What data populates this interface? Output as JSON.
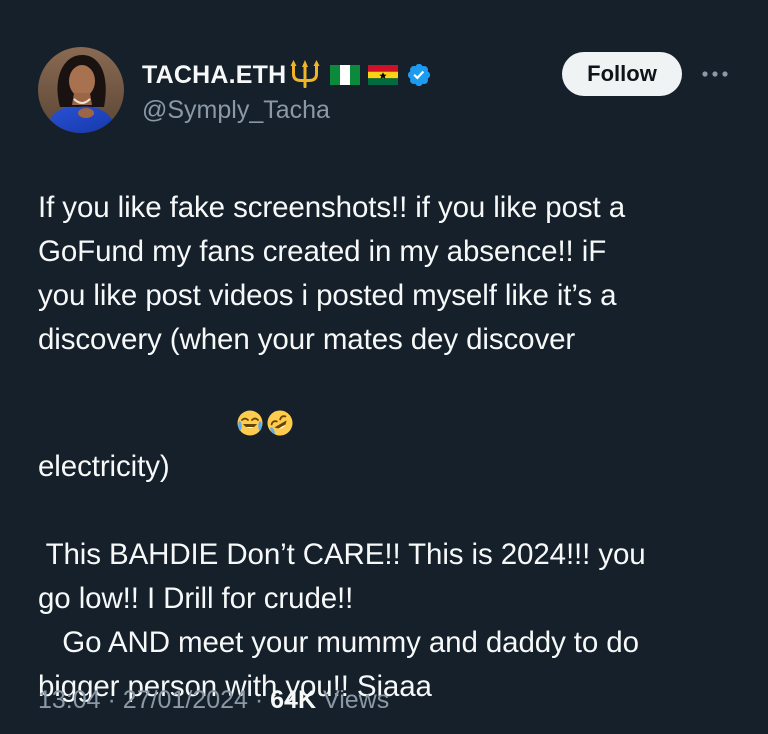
{
  "author": {
    "display_name": "TACHA.ETH",
    "handle": "@Symply_Tacha",
    "emoji_icons": [
      "trident-emoji",
      "nigeria-flag",
      "ghana-flag"
    ],
    "verified_icon": "verified-badge-icon"
  },
  "actions": {
    "follow_label": "Follow",
    "more_icon": "more-horizontal-icon"
  },
  "tweet": {
    "lines": [
      "If you like fake screenshots!! if you like post a",
      "GoFund my fans created in my absence!! iF",
      "you like post videos i posted myself like it’s a",
      "discovery (when your mates dey discover",
      "electricity)",
      " This BAHDIE Don’t CARE!! This is 2024!!! you",
      "go low!! I Drill for crude!!",
      "   Go AND meet your mummy and daddy to do",
      "bigger person with you!! Siaaa"
    ],
    "inline_emojis": [
      "joy-emoji",
      "rofl-emoji"
    ]
  },
  "meta": {
    "time": "13:04",
    "date": "27/01/2024",
    "separator": "·",
    "views_count": "64K",
    "views_label": "Views"
  },
  "colors": {
    "background": "#15202b",
    "text": "#f7f9f9",
    "secondary": "#8b98a5",
    "verified": "#1d9bf0",
    "follow_bg": "#eff3f4"
  }
}
